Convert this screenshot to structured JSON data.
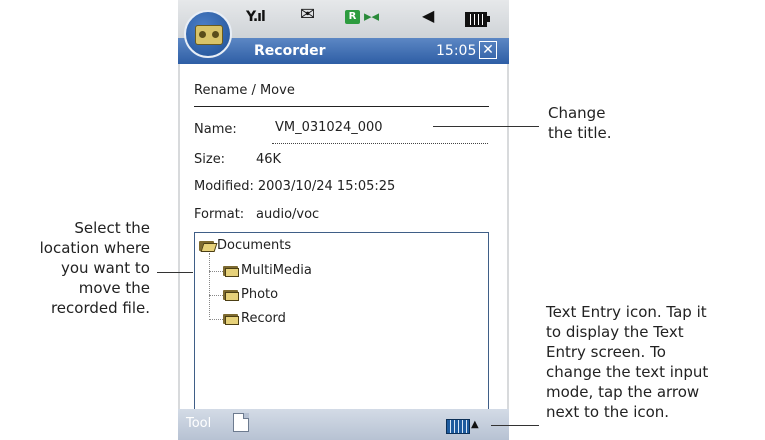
{
  "status": {
    "icons": [
      "signal-icon",
      "envelope-icon",
      "r-badge-icon",
      "bluetooth-icon",
      "speaker-icon",
      "battery-icon"
    ],
    "r_badge": "R"
  },
  "titlebar": {
    "app_title": "Recorder",
    "time": "15:05",
    "close": "✕"
  },
  "dialog": {
    "heading": "Rename / Move",
    "name_label": "Name:",
    "name_value": "VM_031024_000",
    "size_label": "Size:",
    "size_value": "46K",
    "modified_label": "Modified:",
    "modified_value": "2003/10/24 15:05:25",
    "format_label": "Format:",
    "format_value": "audio/voc"
  },
  "tree": {
    "root": "Documents",
    "children": [
      "MultiMedia",
      "Photo",
      "Record"
    ]
  },
  "bottombar": {
    "tool_label": "Tool",
    "arrow": "▲"
  },
  "callouts": {
    "change_title": "Change\nthe title.",
    "select_location": "Select the\nlocation where\nyou want to\nmove the\nrecorded file.",
    "text_entry": "Text Entry icon. Tap it\nto display the Text\nEntry screen. To\nchange the text input\nmode, tap the arrow\nnext to the icon."
  },
  "colors": {
    "titlebar": "#2e5ea5",
    "bottombar": "#b7c2d3",
    "tree_border": "#3f5e87"
  }
}
